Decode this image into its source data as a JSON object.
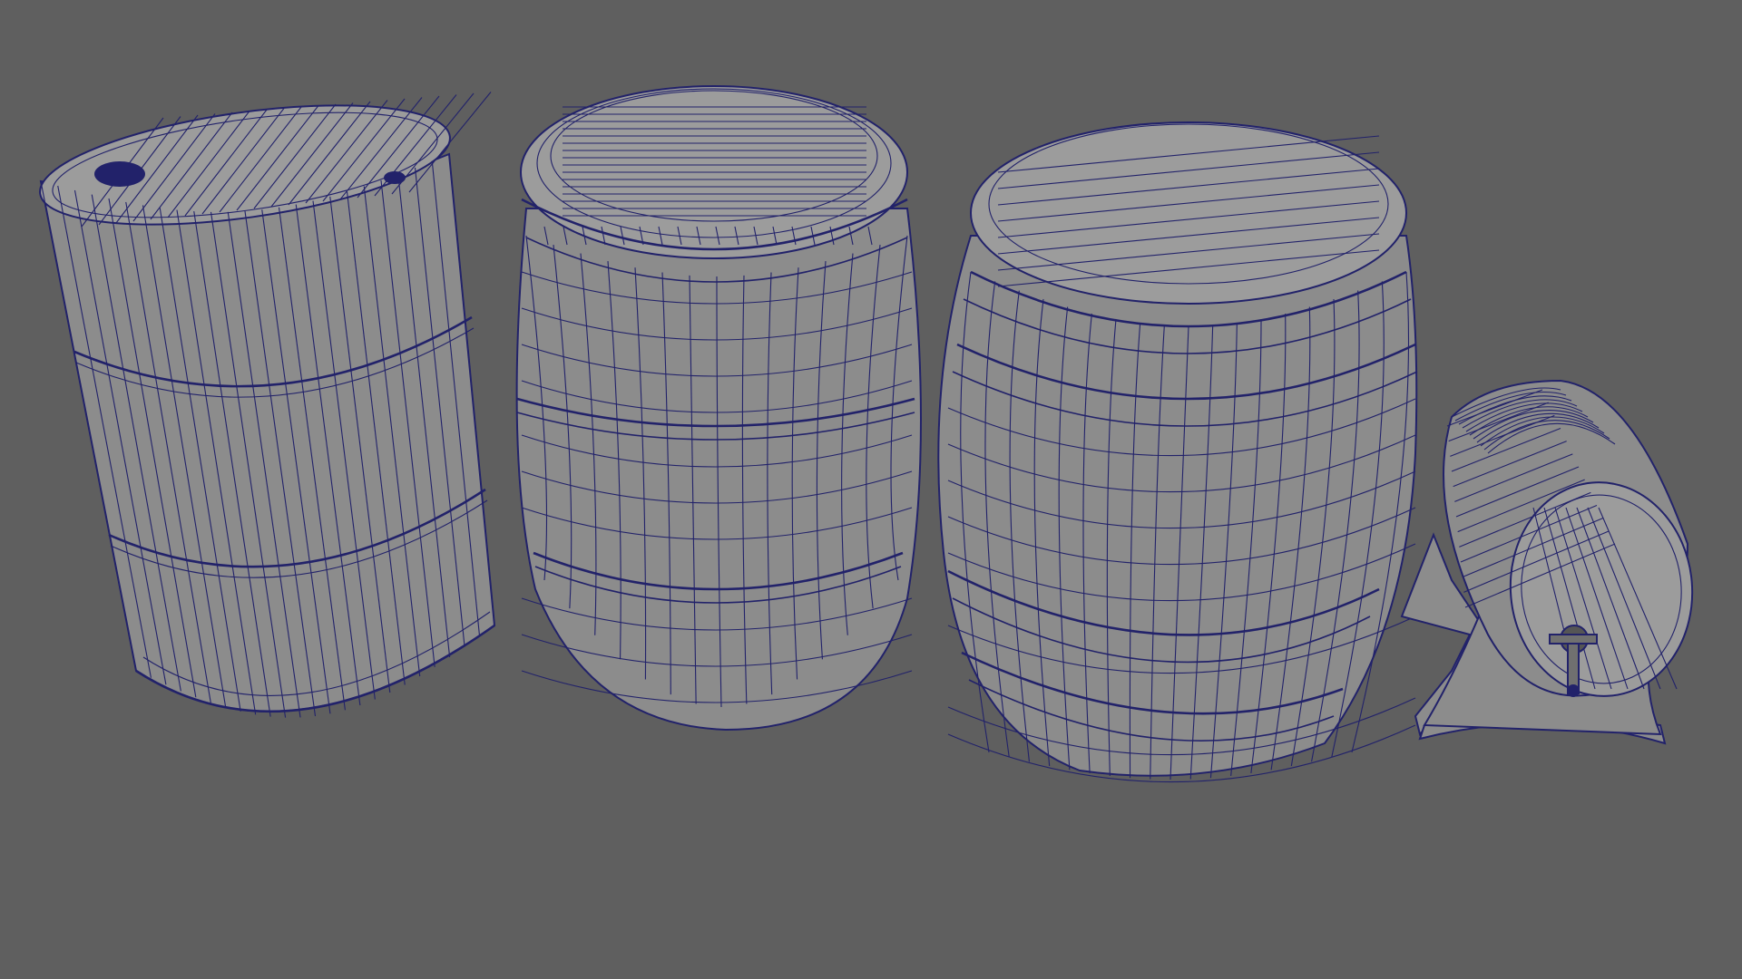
{
  "scene": {
    "viewport": "wireframe-on-shaded",
    "background_color": "#5f5f5f",
    "mesh_fill_color": "#8c8c8c",
    "wire_color": "#22226a",
    "objects": [
      {
        "name": "oil-drum",
        "kind": "steel drum with two ribs and two bungs"
      },
      {
        "name": "plastic-barrel",
        "kind": "rounded plastic barrel with lid"
      },
      {
        "name": "wooden-barrel",
        "kind": "large wooden barrel with hoops"
      },
      {
        "name": "small-keg",
        "kind": "small keg on stand with tap"
      }
    ]
  }
}
